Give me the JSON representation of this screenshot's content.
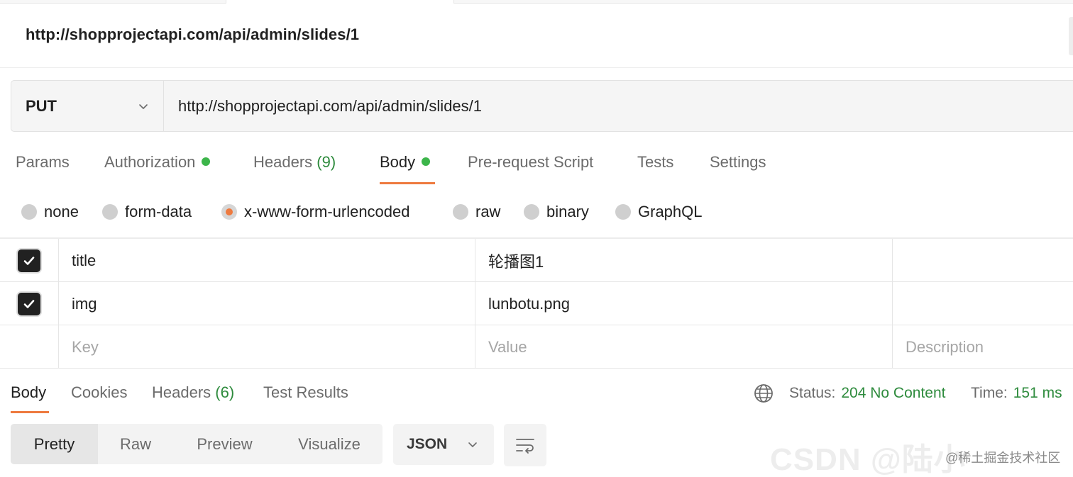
{
  "request": {
    "title": "http://shopprojectapi.com/api/admin/slides/1",
    "method": "PUT",
    "url": "http://shopprojectapi.com/api/admin/slides/1"
  },
  "request_tabs": {
    "params": "Params",
    "authorization": "Authorization",
    "headers": "Headers",
    "headers_count": "(9)",
    "body": "Body",
    "pre_request": "Pre-request Script",
    "tests": "Tests",
    "settings": "Settings"
  },
  "body_types": {
    "none": "none",
    "form_data": "form-data",
    "urlencoded": "x-www-form-urlencoded",
    "raw": "raw",
    "binary": "binary",
    "graphql": "GraphQL",
    "selected": "x-www-form-urlencoded"
  },
  "params": {
    "rows": [
      {
        "key": "title",
        "value": "轮播图1",
        "checked": true
      },
      {
        "key": "img",
        "value": "lunbotu.png",
        "checked": true
      }
    ],
    "placeholder_key": "Key",
    "placeholder_value": "Value",
    "placeholder_description": "Description"
  },
  "response_tabs": {
    "body": "Body",
    "cookies": "Cookies",
    "headers": "Headers",
    "headers_count": "(6)",
    "test_results": "Test Results"
  },
  "response_status": {
    "status_label": "Status:",
    "status_value": "204 No Content",
    "time_label": "Time:",
    "time_value": "151 ms"
  },
  "view_modes": {
    "pretty": "Pretty",
    "raw": "Raw",
    "preview": "Preview",
    "visualize": "Visualize"
  },
  "format": {
    "selected": "JSON"
  },
  "watermark": {
    "main": "CSDN @陆小",
    "sub": "@稀土掘金技术社区"
  },
  "colors": {
    "accent": "#ee7a3f",
    "success": "#2e8b3d",
    "dot": "#3cb54a"
  },
  "icons": [
    "chevron-down-icon",
    "check-icon",
    "globe-icon",
    "wrap-lines-icon"
  ]
}
